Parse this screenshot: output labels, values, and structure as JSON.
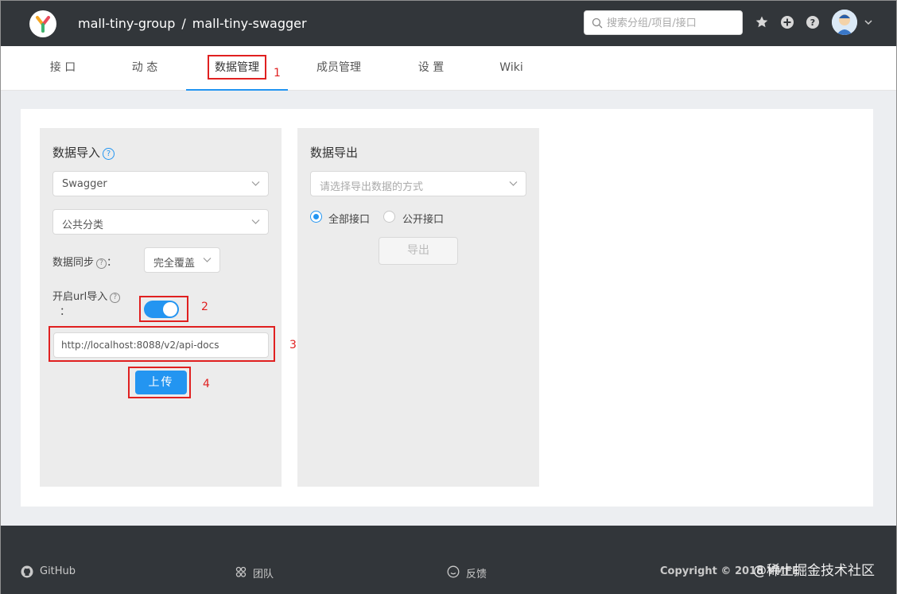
{
  "header": {
    "group": "mall-tiny-group",
    "separator": "/",
    "project": "mall-tiny-swagger",
    "search_placeholder": "搜索分组/项目/接口"
  },
  "tabs": [
    {
      "label": "接 口"
    },
    {
      "label": "动 态"
    },
    {
      "label": "数据管理",
      "active": true
    },
    {
      "label": "成员管理"
    },
    {
      "label": "设 置"
    },
    {
      "label": "Wiki"
    }
  ],
  "annotations": [
    "1",
    "2",
    "3",
    "4"
  ],
  "import": {
    "title": "数据导入",
    "source_select": "Swagger",
    "category_select": "公共分类",
    "sync_label": "数据同步",
    "sync_colon": "：",
    "sync_select": "完全覆盖",
    "url_label_line1": "开启url导入",
    "url_label_line2": "：",
    "url_toggle_on": true,
    "url_value": "http://localhost:8088/v2/api-docs",
    "upload_button": "上传"
  },
  "export": {
    "title": "数据导出",
    "method_placeholder": "请选择导出数据的方式",
    "radio_all": "全部接口",
    "radio_public": "公开接口",
    "radio_selected": "all",
    "export_button": "导出"
  },
  "footer": {
    "github": "GitHub",
    "team": "团队",
    "feedback": "反馈",
    "copyright": "Copyright © 2018 YMFE",
    "watermark": "@稀土掘金技术社区"
  },
  "colors": {
    "header_bg": "#32363a",
    "accent": "#2395f1",
    "annotation": "#e02020"
  }
}
